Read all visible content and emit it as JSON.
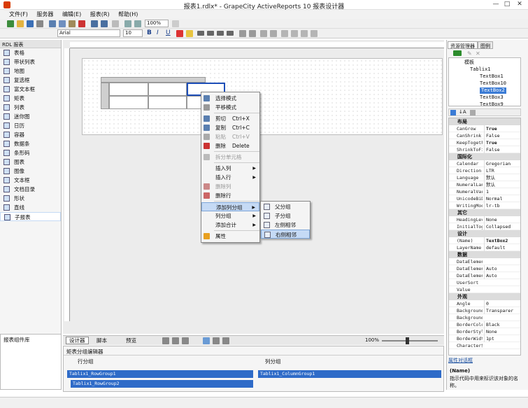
{
  "window": {
    "title": "报表1.rdlx* - GrapeCity ActiveReports 10 报表设计器",
    "controls": [
      "—",
      "□",
      "✕"
    ]
  },
  "menubar": {
    "items": [
      "文件(F)",
      "服务器",
      "编辑(E)",
      "报表(R)",
      "帮助(H)"
    ]
  },
  "toolbar": {
    "zoom": "100%",
    "font_name": "Arial",
    "font_size": "10",
    "bold": "B",
    "italic": "I",
    "underline": "U"
  },
  "toolbox": {
    "header": "RDL 报表",
    "items": [
      "表格",
      "带状列表",
      "地图",
      "复选框",
      "富文本框",
      "矩表",
      "列表",
      "迷你图",
      "日历",
      "容器",
      "数据条",
      "条形码",
      "图表",
      "图像",
      "文本框",
      "文档目录",
      "形状",
      "直线",
      "子报表"
    ]
  },
  "context_menu": {
    "items": [
      {
        "label": "选择模式",
        "shortcut": "",
        "disabled": false,
        "submenu": false
      },
      {
        "label": "平移模式",
        "shortcut": "",
        "disabled": false,
        "submenu": false
      },
      {
        "label": "剪切",
        "shortcut": "Ctrl+X",
        "disabled": false,
        "submenu": false
      },
      {
        "label": "复制",
        "shortcut": "Ctrl+C",
        "disabled": false,
        "submenu": false
      },
      {
        "label": "粘贴",
        "shortcut": "Ctrl+V",
        "disabled": true,
        "submenu": false
      },
      {
        "label": "删除",
        "shortcut": "Delete",
        "disabled": false,
        "submenu": false
      },
      {
        "label": "拆分单元格",
        "shortcut": "",
        "disabled": true,
        "submenu": false
      },
      {
        "label": "插入列",
        "shortcut": "",
        "disabled": false,
        "submenu": true
      },
      {
        "label": "插入行",
        "shortcut": "",
        "disabled": false,
        "submenu": true
      },
      {
        "label": "删除列",
        "shortcut": "",
        "disabled": true,
        "submenu": false
      },
      {
        "label": "删除行",
        "shortcut": "",
        "disabled": false,
        "submenu": false
      },
      {
        "label": "添加列分组",
        "shortcut": "",
        "disabled": false,
        "submenu": true
      },
      {
        "label": "列分组",
        "shortcut": "",
        "disabled": false,
        "submenu": true
      },
      {
        "label": "添加合计",
        "shortcut": "",
        "disabled": false,
        "submenu": true
      },
      {
        "label": "属性",
        "shortcut": "",
        "disabled": false,
        "submenu": false
      }
    ]
  },
  "submenu": {
    "items": [
      "父分组",
      "子分组",
      "左侧相邻",
      "右侧相邻"
    ],
    "highlighted": "右侧相邻"
  },
  "right_panel": {
    "tabs": [
      "资源管理器",
      "图例"
    ],
    "tree": {
      "root": "模板",
      "table": "Tablix1",
      "nodes": [
        "TextBox1",
        "TextBox10",
        "TextBox2",
        "TextBox3",
        "TextBox9"
      ],
      "selected": "TextBox2"
    },
    "properties": [
      {
        "category": "布局",
        "rows": [
          [
            "CanGrow",
            "True",
            true
          ],
          [
            "CanShrink",
            "False",
            false
          ],
          [
            "KeepTogeth",
            "True",
            true
          ],
          [
            "ShrinkToFi",
            "False",
            false
          ]
        ]
      },
      {
        "category": "国际化",
        "rows": [
          [
            "Calendar",
            "Gregorian",
            false
          ],
          [
            "Direction",
            "LTR",
            false
          ],
          [
            "Language",
            "默认",
            false
          ],
          [
            "NumeralLan",
            "默认",
            false
          ],
          [
            "NumeralVar",
            "1",
            false
          ],
          [
            "UnicodeBiD",
            "Normal",
            false
          ],
          [
            "WritingMod",
            "lr-tb",
            false
          ]
        ]
      },
      {
        "category": "其它",
        "rows": [
          [
            "HeadingLev",
            "None",
            false
          ],
          [
            "InitialTog",
            "Collapsed",
            false
          ]
        ]
      },
      {
        "category": "设计",
        "rows": [
          [
            "(Name)",
            "TextBox2",
            true
          ],
          [
            "LayerName",
            "default",
            false
          ]
        ]
      },
      {
        "category": "数据",
        "rows": [
          [
            "DataElemen",
            "",
            false
          ],
          [
            "DataElemen",
            "Auto",
            false
          ],
          [
            "DataElemen",
            "Auto",
            false
          ],
          [
            "UserSort",
            "",
            false
          ],
          [
            "Value",
            "",
            false
          ]
        ]
      },
      {
        "category": "外观",
        "rows": [
          [
            "Angle",
            "0",
            false
          ],
          [
            "Background",
            "Transparer",
            false
          ],
          [
            "Background",
            "",
            false
          ],
          [
            "BorderColo",
            "Black",
            false
          ],
          [
            "BorderStyl",
            "None",
            false
          ],
          [
            "BorderWidt",
            "1pt",
            false
          ],
          [
            "CharacterSp",
            "",
            false
          ]
        ]
      }
    ],
    "property_link": "属性对话框",
    "desc_title": "(Name)",
    "desc_text": "指示代码中用来标识该对象的名称。"
  },
  "bottom": {
    "tabs": [
      "设计器",
      "脚本",
      "预览"
    ],
    "zoom": "100%",
    "report_library": "报表组件库",
    "group_editor_title": "矩表分组编辑器",
    "row_group_label": "行分组",
    "col_group_label": "列分组",
    "row_groups": [
      "Tablix1_RowGroup1",
      "Tablix1_RowGroup2"
    ],
    "col_groups": [
      "Tablix1_ColumnGroup1"
    ]
  },
  "colors": {
    "accent": "#2e6bc8",
    "highlight": "#c5daf5",
    "selected_tree": "#3a7bd5"
  }
}
